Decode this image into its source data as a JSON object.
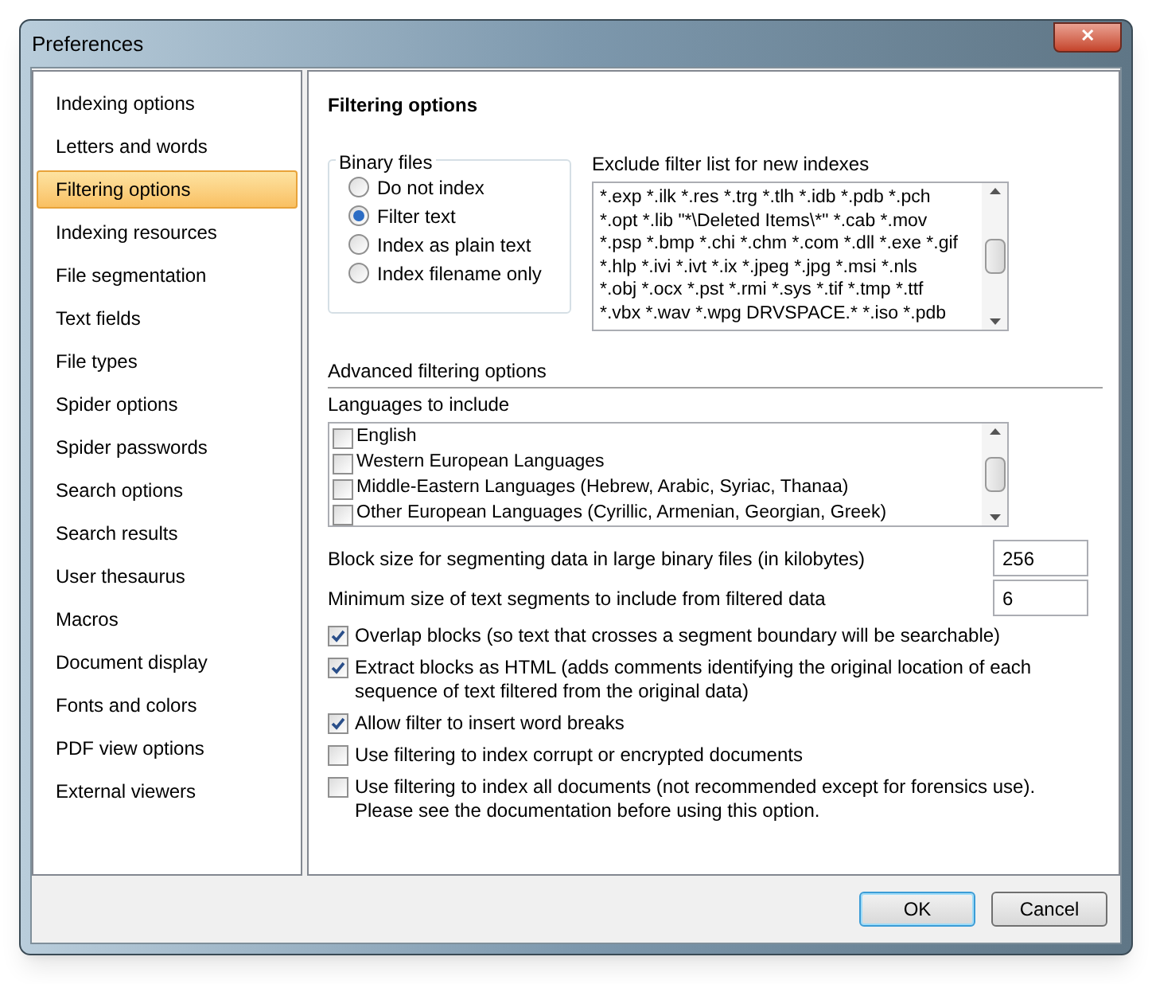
{
  "window": {
    "title": "Preferences",
    "close_label": "✕"
  },
  "sidebar": {
    "items": [
      {
        "label": "Indexing options",
        "selected": false
      },
      {
        "label": "Letters and words",
        "selected": false
      },
      {
        "label": "Filtering options",
        "selected": true
      },
      {
        "label": "Indexing resources",
        "selected": false
      },
      {
        "label": "File segmentation",
        "selected": false
      },
      {
        "label": "Text fields",
        "selected": false
      },
      {
        "label": "File types",
        "selected": false
      },
      {
        "label": "Spider options",
        "selected": false
      },
      {
        "label": "Spider passwords",
        "selected": false
      },
      {
        "label": "Search options",
        "selected": false
      },
      {
        "label": "Search results",
        "selected": false
      },
      {
        "label": "User thesaurus",
        "selected": false
      },
      {
        "label": "Macros",
        "selected": false
      },
      {
        "label": "Document display",
        "selected": false
      },
      {
        "label": "Fonts and colors",
        "selected": false
      },
      {
        "label": "PDF view options",
        "selected": false
      },
      {
        "label": "External viewers",
        "selected": false
      }
    ]
  },
  "page": {
    "heading": "Filtering options",
    "binary_files": {
      "title": "Binary files",
      "options": [
        {
          "label": "Do not index",
          "selected": false
        },
        {
          "label": "Filter text",
          "selected": true
        },
        {
          "label": "Index as plain text",
          "selected": false
        },
        {
          "label": "Index filename only",
          "selected": false
        }
      ]
    },
    "exclude_list": {
      "label": "Exclude filter list for new indexes",
      "lines": [
        "*.exp *.ilk *.res *.trg *.tlh *.idb *.pdb *.pch",
        "*.opt *.lib \"*\\Deleted Items\\*\" *.cab *.mov",
        "*.psp *.bmp *.chi *.chm *.com *.dll *.exe *.gif",
        "*.hlp *.ivi *.ivt *.ix *.jpeg *.jpg *.msi *.nls",
        "*.obj *.ocx *.pst *.rmi *.sys *.tif *.tmp *.ttf",
        "*.vbx *.wav *.wpg DRVSPACE.* *.iso *.pdb"
      ]
    },
    "advanced_heading": "Advanced filtering options",
    "languages": {
      "label": "Languages to include",
      "items": [
        {
          "label": "English",
          "checked": false
        },
        {
          "label": "Western European Languages",
          "checked": false
        },
        {
          "label": "Middle-Eastern Languages (Hebrew, Arabic, Syriac, Thanaa)",
          "checked": false
        },
        {
          "label": "Other European Languages (Cyrillic, Armenian, Georgian, Greek)",
          "checked": false
        }
      ]
    },
    "numbers": [
      {
        "label": "Block size for segmenting data in large binary files (in kilobytes)",
        "value": "256"
      },
      {
        "label": "Minimum size of text segments to include from filtered data",
        "value": "6"
      }
    ],
    "checkboxes": [
      {
        "label": "Overlap blocks (so text that crosses a segment boundary will be searchable)",
        "checked": true
      },
      {
        "label": "Extract blocks as HTML (adds comments identifying the original location of each sequence of text filtered from the original data)",
        "checked": true
      },
      {
        "label": "Allow filter to insert word breaks",
        "checked": true
      },
      {
        "label": "Use filtering to index corrupt or encrypted documents",
        "checked": false
      },
      {
        "label": "Use filtering to index all documents (not recommended except for forensics use).  Please see the documentation before using this option.",
        "checked": false
      }
    ]
  },
  "buttons": [
    {
      "label": "OK",
      "default": true
    },
    {
      "label": "Cancel",
      "default": false
    }
  ]
}
